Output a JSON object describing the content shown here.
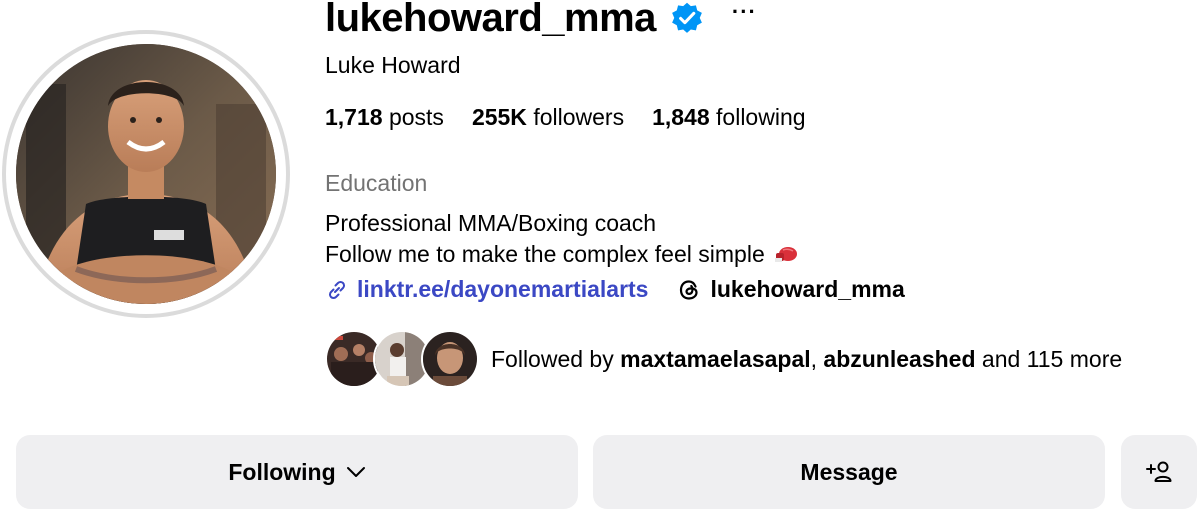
{
  "profile": {
    "username": "lukehoward_mma",
    "verified_icon": "verified-badge-icon",
    "more_label": "···",
    "full_name": "Luke Howard"
  },
  "stats": {
    "posts_count": "1,718",
    "posts_label": "posts",
    "followers_count": "255K",
    "followers_label": "followers",
    "following_count": "1,848",
    "following_label": "following"
  },
  "bio": {
    "category": "Education",
    "line1": "Professional MMA/Boxing coach",
    "line2": "Follow me to make the complex feel simple"
  },
  "links": {
    "website": "linktr.ee/dayonemartialarts",
    "threads": "lukehoward_mma"
  },
  "followed_by": {
    "prefix": "Followed by ",
    "user1": "maxtamaelasapal",
    "separator": ", ",
    "user2": "abzunleashed",
    "suffix": " and 115 more"
  },
  "buttons": {
    "following": "Following",
    "message": "Message"
  },
  "colors": {
    "link": "#3b48c4",
    "verified": "#0095f6",
    "button_bg": "#efeff1",
    "category": "#737373"
  }
}
